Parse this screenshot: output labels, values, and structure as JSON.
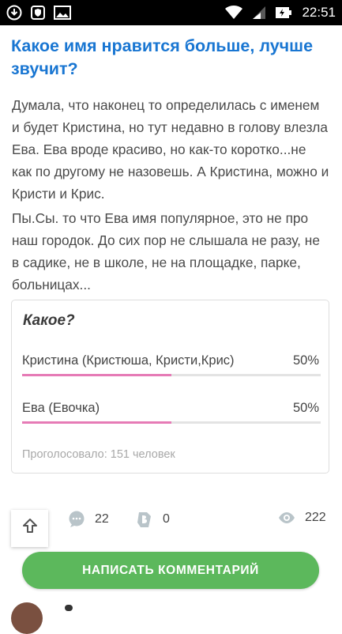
{
  "status_bar": {
    "time": "22:51",
    "icons": [
      "download-icon",
      "shield-app-icon",
      "image-icon",
      "wifi-icon",
      "signal-icon",
      "battery-icon"
    ]
  },
  "post": {
    "title": "Какое имя нравится больше, лучше звучит?",
    "paragraphs": [
      "Думала, что наконец то определилась с именем и будет Кристина, но тут недавно в голову влезла Ева. Ева вроде красиво, но как-то коротко...не как по другому не назовешь. А Кристина, можно и Кристи и Крис.",
      "Пы.Сы. то что Ева имя популярное, это не про наш городок. До сих пор не слышала не разу, не в садике, не в школе, не на площадке, парке, больницах..."
    ]
  },
  "poll": {
    "question": "Какое?",
    "options": [
      {
        "label": "Кристина (Кристюша, Кристи,Крис)",
        "percent_label": "50%",
        "percent": 50
      },
      {
        "label": "Ева (Евочка)",
        "percent_label": "50%",
        "percent": 50
      }
    ],
    "total": "Проголосовало: 151 человек"
  },
  "stats": {
    "comments": "22",
    "likes": "0",
    "views": "222"
  },
  "cta": {
    "label": "НАПИСАТЬ КОММЕНТАРИЙ"
  },
  "colors": {
    "accent_blue": "#1976d2",
    "poll_bar": "#e67bb6",
    "cta_green": "#5cb85c"
  }
}
